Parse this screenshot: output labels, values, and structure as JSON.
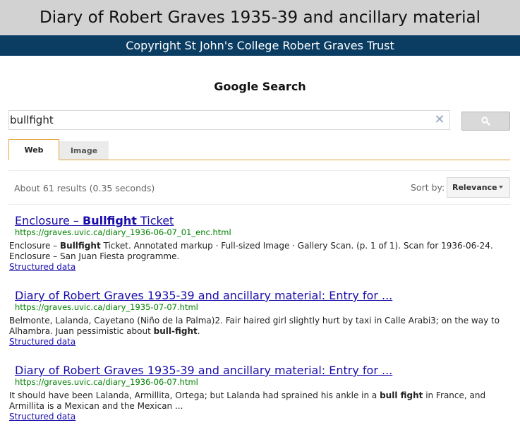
{
  "header": {
    "title": "Diary of Robert Graves 1935-39 and ancillary material",
    "copyright": "Copyright St John's College Robert Graves Trust"
  },
  "search": {
    "heading": "Google Search",
    "query": "bullfight",
    "clear_icon": "close-icon",
    "search_button_icon": "magnifier-icon"
  },
  "tabs": [
    {
      "label": "Web",
      "active": true
    },
    {
      "label": "Image",
      "active": false
    }
  ],
  "results_meta": {
    "info": "About 61 results (0.35 seconds)",
    "sort_label": "Sort by:",
    "sort_value": "Relevance"
  },
  "results": [
    {
      "title_pre": "Enclosure – ",
      "title_bold": "Bullfight",
      "title_post": " Ticket",
      "url": "https://graves.uvic.ca/diary_1936-06-07_01_enc.html",
      "snippet_pre": "Enclosure – ",
      "snippet_bold": "Bullfight",
      "snippet_post": " Ticket. Annotated markup · Full-sized Image · Gallery Scan. (p. 1 of 1). Scan for 1936-06-24. Enclosure – San Juan Fiesta programme.",
      "structured_link": "Structured data"
    },
    {
      "title_pre": "Diary of Robert Graves 1935-39 and ancillary material: Entry for ...",
      "title_bold": "",
      "title_post": "",
      "url": "https://graves.uvic.ca/diary_1935-07-07.html",
      "snippet_pre": "Belmonte, Lalanda, Cayetano (Niño de la Palma)2. Fair haired girl slightly hurt by taxi in Calle Arabi3; on the way to Alhambra. Juan pessimistic about ",
      "snippet_bold": "bull-fight",
      "snippet_post": ".",
      "structured_link": "Structured data"
    },
    {
      "title_pre": "Diary of Robert Graves 1935-39 and ancillary material: Entry for ...",
      "title_bold": "",
      "title_post": "",
      "url": "https://graves.uvic.ca/diary_1936-06-07.html",
      "snippet_pre": "It should have been Lalanda, Armillita, Ortega; but Lalanda had sprained his ankle in a ",
      "snippet_bold": "bull fight",
      "snippet_post": " in France, and Armillita is a Mexican and the Mexican ...",
      "structured_link": "Structured data"
    }
  ]
}
